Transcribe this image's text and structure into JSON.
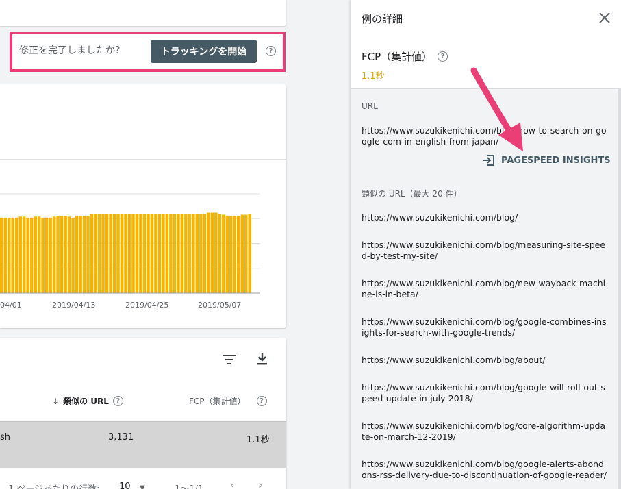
{
  "tracking": {
    "question": "修正を完了しましたか？",
    "button": "トラッキングを開始",
    "help": "?"
  },
  "chart_data": {
    "type": "bar",
    "title": "",
    "xlabel": "",
    "ylabel": "",
    "tick_labels": [
      "04/01",
      "2019/04/13",
      "2019/04/25",
      "2019/05/07"
    ],
    "values": [
      76,
      76,
      76,
      76,
      76,
      77,
      77,
      76,
      76,
      77,
      77,
      76,
      76,
      76,
      77,
      78,
      78,
      78,
      77,
      76,
      78,
      78,
      78,
      78,
      80,
      80,
      80,
      80,
      80,
      80,
      80,
      80,
      80,
      80,
      80,
      80,
      80,
      80,
      80,
      80,
      80,
      80,
      80,
      80,
      80,
      80,
      80,
      80,
      80,
      80,
      80,
      80,
      80,
      80,
      80,
      81,
      81,
      81,
      80,
      79,
      78,
      78,
      78,
      78,
      79,
      79,
      80
    ],
    "ylim": [
      0,
      100
    ],
    "color": "#f4b400"
  },
  "table": {
    "sort_col": "類似の URL",
    "metric_col": "FCP（集計値）",
    "row": {
      "url": "sh",
      "count": "3,131",
      "value": "1.1秒"
    },
    "pager": {
      "rows_label": "1 ページあたりの行数:",
      "rows_value": "10",
      "range": "1〜1/1"
    }
  },
  "panel": {
    "title": "例の詳細",
    "metric_label": "FCP（集計値）",
    "metric_value": "1.1秒",
    "url_label": "URL",
    "main_url": "https://www.suzukikenichi.com/blog/how-to-search-on-google-com-in-english-from-japan/",
    "psi_label": "PAGESPEED INSIGHTS",
    "similar_label": "類似の URL（最大 20 件）",
    "similar_urls": [
      "https://www.suzukikenichi.com/blog/",
      "https://www.suzukikenichi.com/blog/measuring-site-speed-by-test-my-site/",
      "https://www.suzukikenichi.com/blog/new-wayback-machine-is-in-beta/",
      "https://www.suzukikenichi.com/blog/google-combines-insights-for-search-with-google-trends/",
      "https://www.suzukikenichi.com/blog/about/",
      "https://www.suzukikenichi.com/blog/google-will-roll-out-speed-update-in-july-2018/",
      "https://www.suzukikenichi.com/blog/core-algorithm-update-on-march-12-2019/",
      "https://www.suzukikenichi.com/blog/google-alerts-abondons-rss-delivery-due-to-discontinuation-of-google-reader/"
    ]
  },
  "colors": {
    "highlight": "#ea3e76",
    "bar": "#f4b400",
    "button": "#455a64"
  }
}
